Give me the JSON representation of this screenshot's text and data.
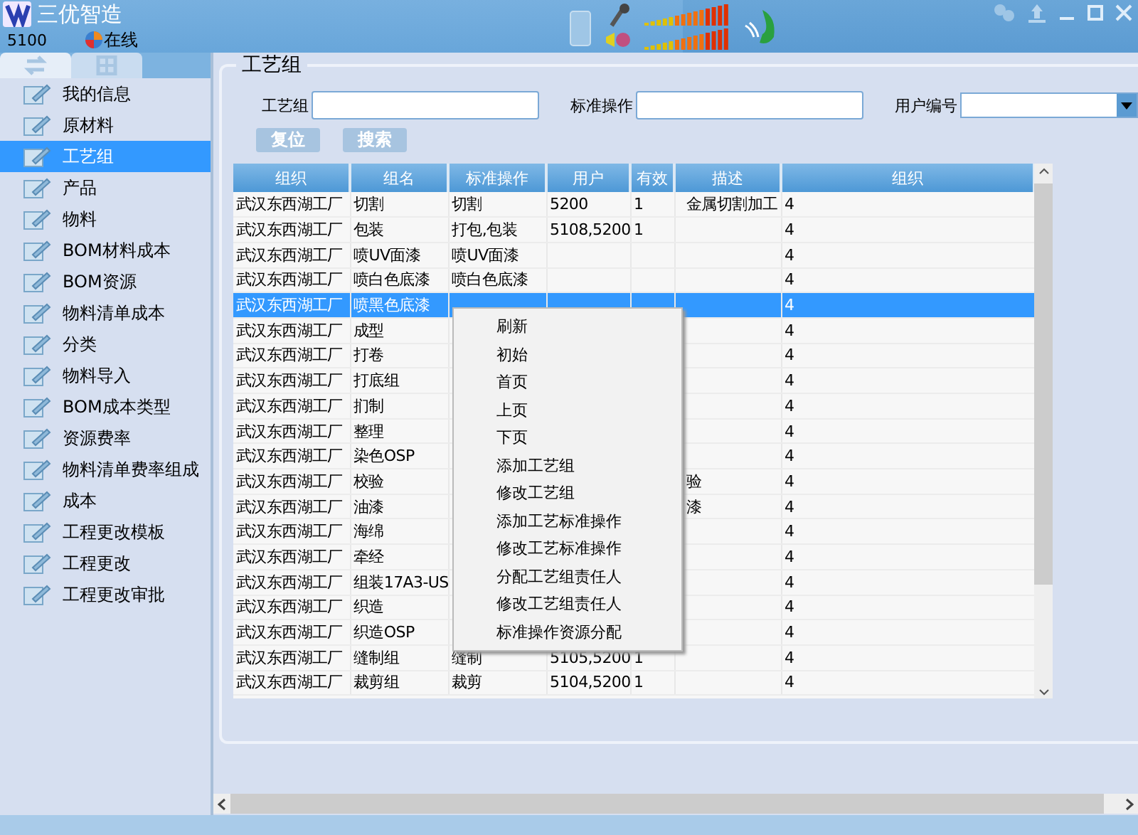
{
  "window": {
    "title": "三优智造",
    "user_id": "5100",
    "status": "在线"
  },
  "sidebar": {
    "tabs": [
      {
        "selected": true
      },
      {
        "selected": false
      }
    ],
    "items": [
      {
        "label": "我的信息",
        "selected": false
      },
      {
        "label": "原材料",
        "selected": false
      },
      {
        "label": "工艺组",
        "selected": true
      },
      {
        "label": "产品",
        "selected": false
      },
      {
        "label": "物料",
        "selected": false
      },
      {
        "label": "BOM材料成本",
        "selected": false
      },
      {
        "label": "BOM资源",
        "selected": false
      },
      {
        "label": "物料清单成本",
        "selected": false
      },
      {
        "label": "分类",
        "selected": false
      },
      {
        "label": "物料导入",
        "selected": false
      },
      {
        "label": "BOM成本类型",
        "selected": false
      },
      {
        "label": "资源费率",
        "selected": false
      },
      {
        "label": "物料清单费率组成",
        "selected": false
      },
      {
        "label": "成本",
        "selected": false
      },
      {
        "label": "工程更改模板",
        "selected": false
      },
      {
        "label": "工程更改",
        "selected": false
      },
      {
        "label": "工程更改审批",
        "selected": false
      }
    ]
  },
  "panel": {
    "title": "工艺组",
    "filters": [
      {
        "label": "工艺组",
        "kind": "text"
      },
      {
        "label": "标准操作",
        "kind": "text"
      },
      {
        "label": "用户编号",
        "kind": "dropdown"
      }
    ],
    "buttons": [
      "复位",
      "搜索"
    ]
  },
  "table": {
    "columns": [
      "组织",
      "组名",
      "标准操作",
      "用户",
      "有效",
      "描述",
      "组织"
    ],
    "rows": [
      {
        "cells": [
          "武汉东西湖工厂",
          "切割",
          "切割",
          "5200",
          "1",
          "金属切割加工",
          "4"
        ],
        "selected": false
      },
      {
        "cells": [
          "武汉东西湖工厂",
          "包装",
          "打包,包装",
          "5108,5200",
          "1",
          "",
          "4"
        ],
        "selected": false
      },
      {
        "cells": [
          "武汉东西湖工厂",
          "喷UV面漆",
          "喷UV面漆",
          "",
          "",
          "",
          "4"
        ],
        "selected": false
      },
      {
        "cells": [
          "武汉东西湖工厂",
          "喷白色底漆",
          "喷白色底漆",
          "",
          "",
          "",
          "4"
        ],
        "selected": false
      },
      {
        "cells": [
          "武汉东西湖工厂",
          "喷黑色底漆",
          "",
          "",
          "",
          "",
          "4"
        ],
        "selected": true
      },
      {
        "cells": [
          "武汉东西湖工厂",
          "成型",
          "",
          "",
          "",
          "",
          "4"
        ],
        "selected": false
      },
      {
        "cells": [
          "武汉东西湖工厂",
          "打卷",
          "",
          "",
          "",
          "",
          "4"
        ],
        "selected": false
      },
      {
        "cells": [
          "武汉东西湖工厂",
          "打底组",
          "",
          "",
          "",
          "",
          "4"
        ],
        "selected": false
      },
      {
        "cells": [
          "武汉东西湖工厂",
          "扪制",
          "",
          "",
          "",
          "",
          "4"
        ],
        "selected": false
      },
      {
        "cells": [
          "武汉东西湖工厂",
          "整理",
          "",
          "",
          "",
          "",
          "4"
        ],
        "selected": false
      },
      {
        "cells": [
          "武汉东西湖工厂",
          "染色OSP",
          "",
          "",
          "",
          "",
          "4"
        ],
        "selected": false
      },
      {
        "cells": [
          "武汉东西湖工厂",
          "校验",
          "",
          "",
          "",
          "验",
          "4"
        ],
        "selected": false
      },
      {
        "cells": [
          "武汉东西湖工厂",
          "油漆",
          "",
          "",
          "",
          "漆",
          "4"
        ],
        "selected": false
      },
      {
        "cells": [
          "武汉东西湖工厂",
          "海绵",
          "",
          "",
          "",
          "",
          "4"
        ],
        "selected": false
      },
      {
        "cells": [
          "武汉东西湖工厂",
          "牵经",
          "",
          "",
          "",
          "",
          "4"
        ],
        "selected": false
      },
      {
        "cells": [
          "武汉东西湖工厂",
          "组装17A3-US",
          "",
          "",
          "",
          "",
          "4"
        ],
        "selected": false
      },
      {
        "cells": [
          "武汉东西湖工厂",
          "织造",
          "",
          "",
          "",
          "",
          "4"
        ],
        "selected": false
      },
      {
        "cells": [
          "武汉东西湖工厂",
          "织造OSP",
          "",
          "",
          "",
          "",
          "4"
        ],
        "selected": false
      },
      {
        "cells": [
          "武汉东西湖工厂",
          "缝制组",
          "缝制",
          "5105,5200",
          "1",
          "",
          "4"
        ],
        "selected": false
      },
      {
        "cells": [
          "武汉东西湖工厂",
          "裁剪组",
          "裁剪",
          "5104,5200",
          "1",
          "",
          "4"
        ],
        "selected": false
      }
    ]
  },
  "context_menu": {
    "items": [
      "刷新",
      "初始",
      "首页",
      "上页",
      "下页",
      "添加工艺组",
      "修改工艺组",
      "添加工艺标准操作",
      "修改工艺标准操作",
      "分配工艺组责任人",
      "修改工艺组责任人",
      "标准操作资源分配"
    ]
  }
}
